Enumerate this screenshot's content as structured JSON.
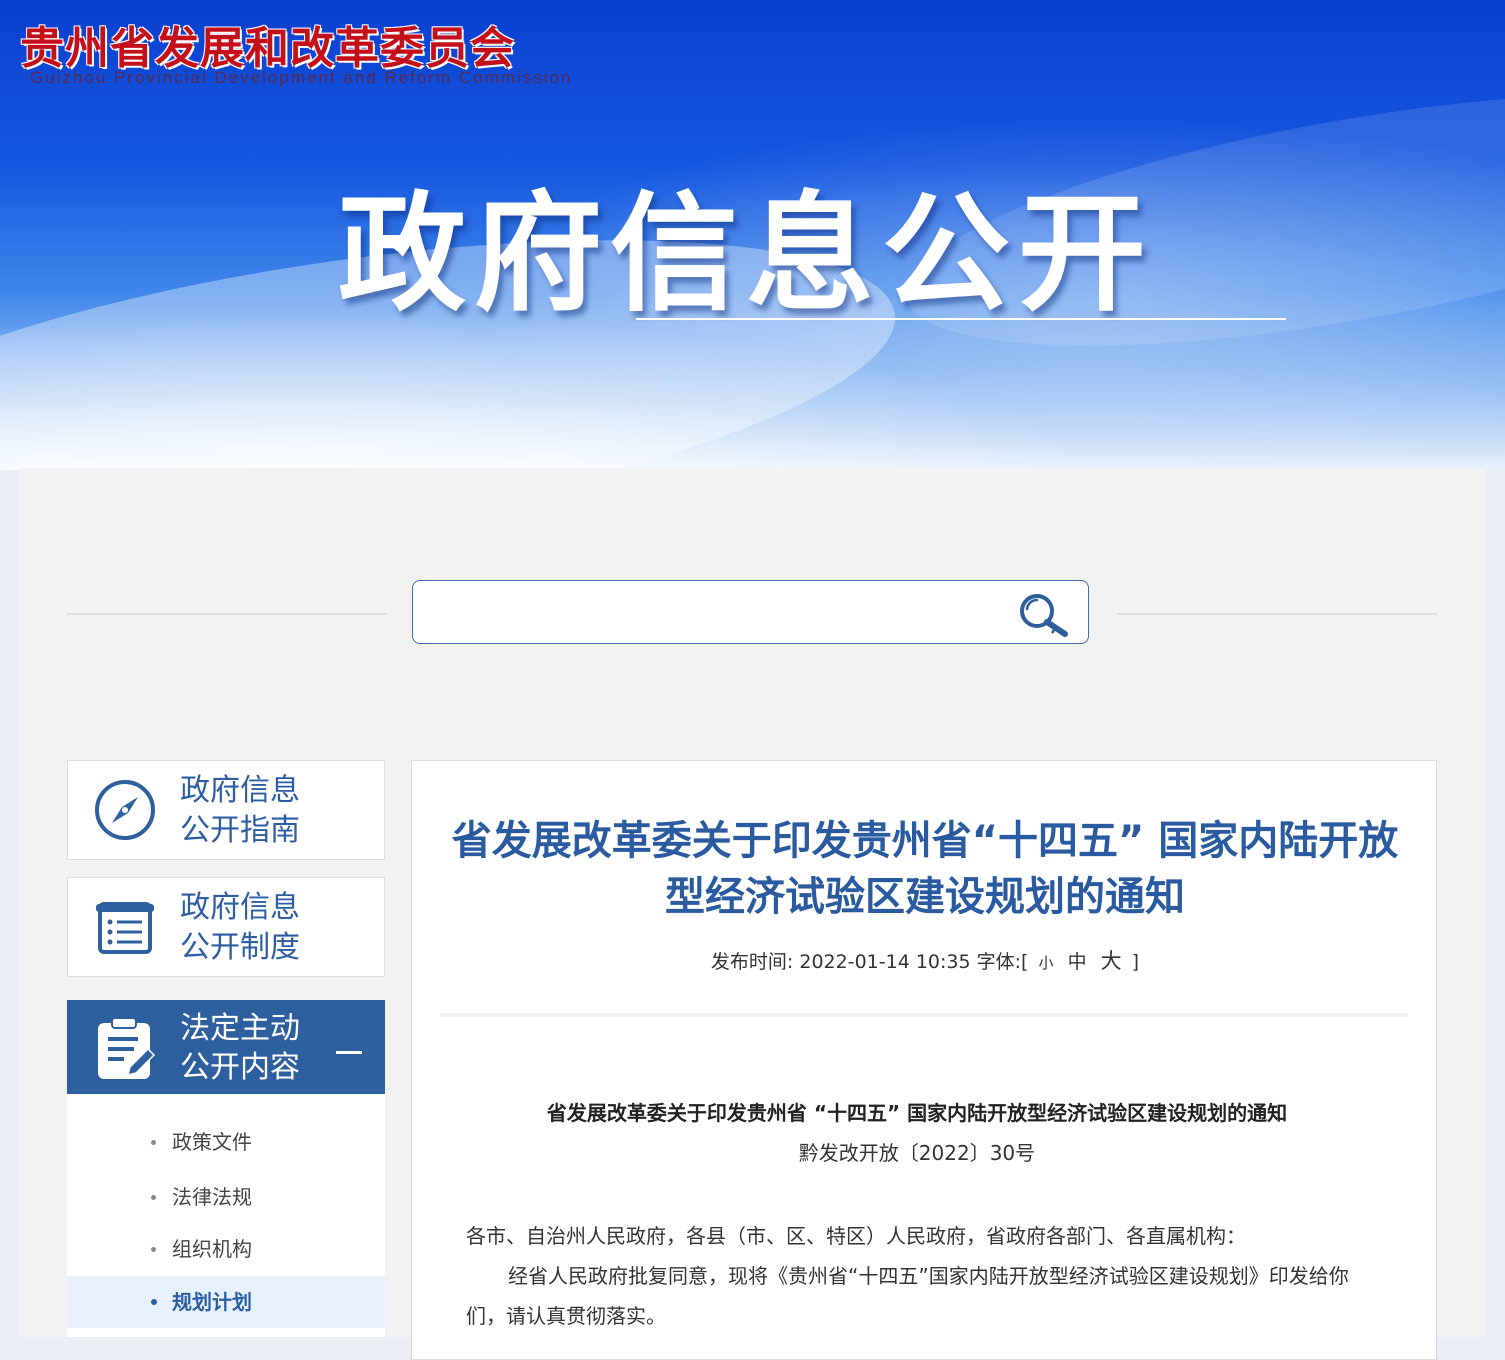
{
  "header": {
    "org_name_cn": "贵州省发展和改革委员会",
    "org_name_en": "Guizhou Provincial Development and Reform Commission",
    "banner_title": "政府信息公开"
  },
  "search": {
    "placeholder": "",
    "value": "",
    "icon": "search-icon"
  },
  "sidebar": {
    "cards": [
      {
        "label_line1": "政府信息",
        "label_line2": "公开指南",
        "icon": "compass-icon"
      },
      {
        "label_line1": "政府信息",
        "label_line2": "公开制度",
        "icon": "list-document-icon"
      },
      {
        "label_line1": "法定主动",
        "label_line2": "公开内容",
        "icon": "edit-clipboard-icon",
        "expanded": true
      }
    ],
    "subitems": [
      {
        "label": "政策文件"
      },
      {
        "label": "法律法规"
      },
      {
        "label": "组织机构"
      },
      {
        "label": "规划计划",
        "current": true
      }
    ],
    "colors": {
      "accent": "#2e5f9e",
      "current_bg": "#e7f1fb"
    }
  },
  "article": {
    "title": "省发展改革委关于印发贵州省“十四五” 国家内陆开放型经济试验区建设规划的通知",
    "meta": {
      "publish_label": "发布时间:",
      "publish_time": "2022-01-14 10:35",
      "font_label": "字体:[",
      "font_small": "小",
      "font_medium": "中",
      "font_large": "大",
      "font_close": "]"
    },
    "doc_title": "省发展改革委关于印发贵州省 “十四五” 国家内陆开放型经济试验区建设规划的通知",
    "doc_number": "黔发改开放〔2022〕30号",
    "paragraphs": [
      "各市、自治州人民政府，各县（市、区、特区）人民政府，省政府各部门、各直属机构：",
      "经省人民政府批复同意，现将《贵州省“十四五”国家内陆开放型经济试验区建设规划》印发给你们，请认真贯彻落实。"
    ]
  },
  "colors": {
    "title_blue": "#2a5aa0",
    "logo_red": "#c4101a"
  }
}
